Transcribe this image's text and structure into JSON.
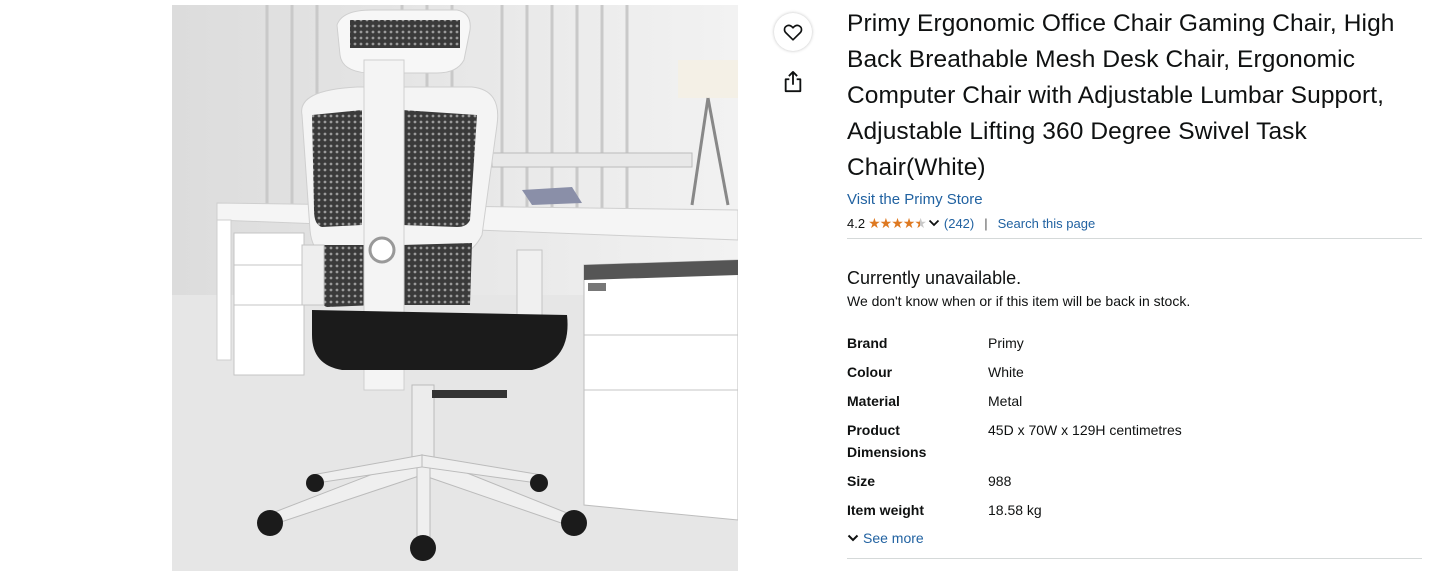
{
  "product": {
    "title": "Primy Ergonomic Office Chair Gaming Chair, High Back Breathable Mesh Desk Chair, Ergonomic Computer Chair with Adjustable Lumbar Support, Adjustable Lifting 360 Degree Swivel Task Chair(White)",
    "store_link": "Visit the Primy Store",
    "image_icon": "office-chair-photo"
  },
  "rating": {
    "value": "4.2",
    "stars": 4.2,
    "count": "(242)",
    "search_link": "Search this page"
  },
  "actions": {
    "favourite_icon": "heart-icon",
    "share_icon": "share-icon"
  },
  "availability": {
    "title": "Currently unavailable.",
    "subtitle": "We don't know when or if this item will be back in stock."
  },
  "specs": [
    {
      "key": "Brand",
      "value": "Primy"
    },
    {
      "key": "Colour",
      "value": "White"
    },
    {
      "key": "Material",
      "value": "Metal"
    },
    {
      "key": "Product Dimensions",
      "value": "45D x 70W x 129H centimetres"
    },
    {
      "key": "Size",
      "value": "988"
    },
    {
      "key": "Item weight",
      "value": "18.58 kg"
    }
  ],
  "see_more": "See more",
  "colors": {
    "link": "#2162a1",
    "star": "#de7921",
    "text": "#0f1111",
    "divider": "#d5d9d9"
  }
}
